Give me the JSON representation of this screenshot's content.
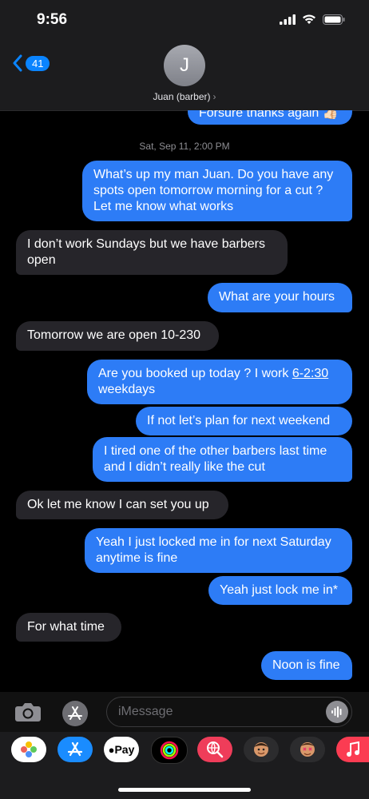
{
  "status": {
    "time": "9:56"
  },
  "header": {
    "back_count": "41",
    "avatar_initial": "J",
    "contact_name": "Juan (barber)",
    "chevron": "›"
  },
  "thread": {
    "partial_top": "Forsure thanks again 👍🏻",
    "timestamp": "Sat, Sep 11, 2:00 PM",
    "messages": [
      {
        "text": "What’s up my man Juan. Do you have any spots open tomorrow morning for a cut ? Let me know what works"
      },
      {
        "text": "I don’t work Sundays but we have barbers open"
      },
      {
        "text": "What are your hours"
      },
      {
        "text": "Tomorrow we are open 10-230"
      },
      {
        "text_before": "Are you booked up today ? I work ",
        "link": "6-2:30",
        "text_after": " weekdays"
      },
      {
        "text": "If not let’s plan for next weekend"
      },
      {
        "text": "I tired one of the other barbers last time and I didn’t really like the cut"
      },
      {
        "text": "Ok let me know I can set you up"
      },
      {
        "text": "Yeah I just locked me in for next Saturday anytime is fine"
      },
      {
        "text": "Yeah just lock me in*"
      },
      {
        "text": "For what time"
      },
      {
        "text": "Noon is fine"
      }
    ]
  },
  "composer": {
    "placeholder": "iMessage"
  },
  "app_drawer": {
    "apple_pay_label": "Pay"
  },
  "colors": {
    "outgoing": "#2d7cf6",
    "incoming": "#26252a",
    "accent": "#0a84ff"
  }
}
